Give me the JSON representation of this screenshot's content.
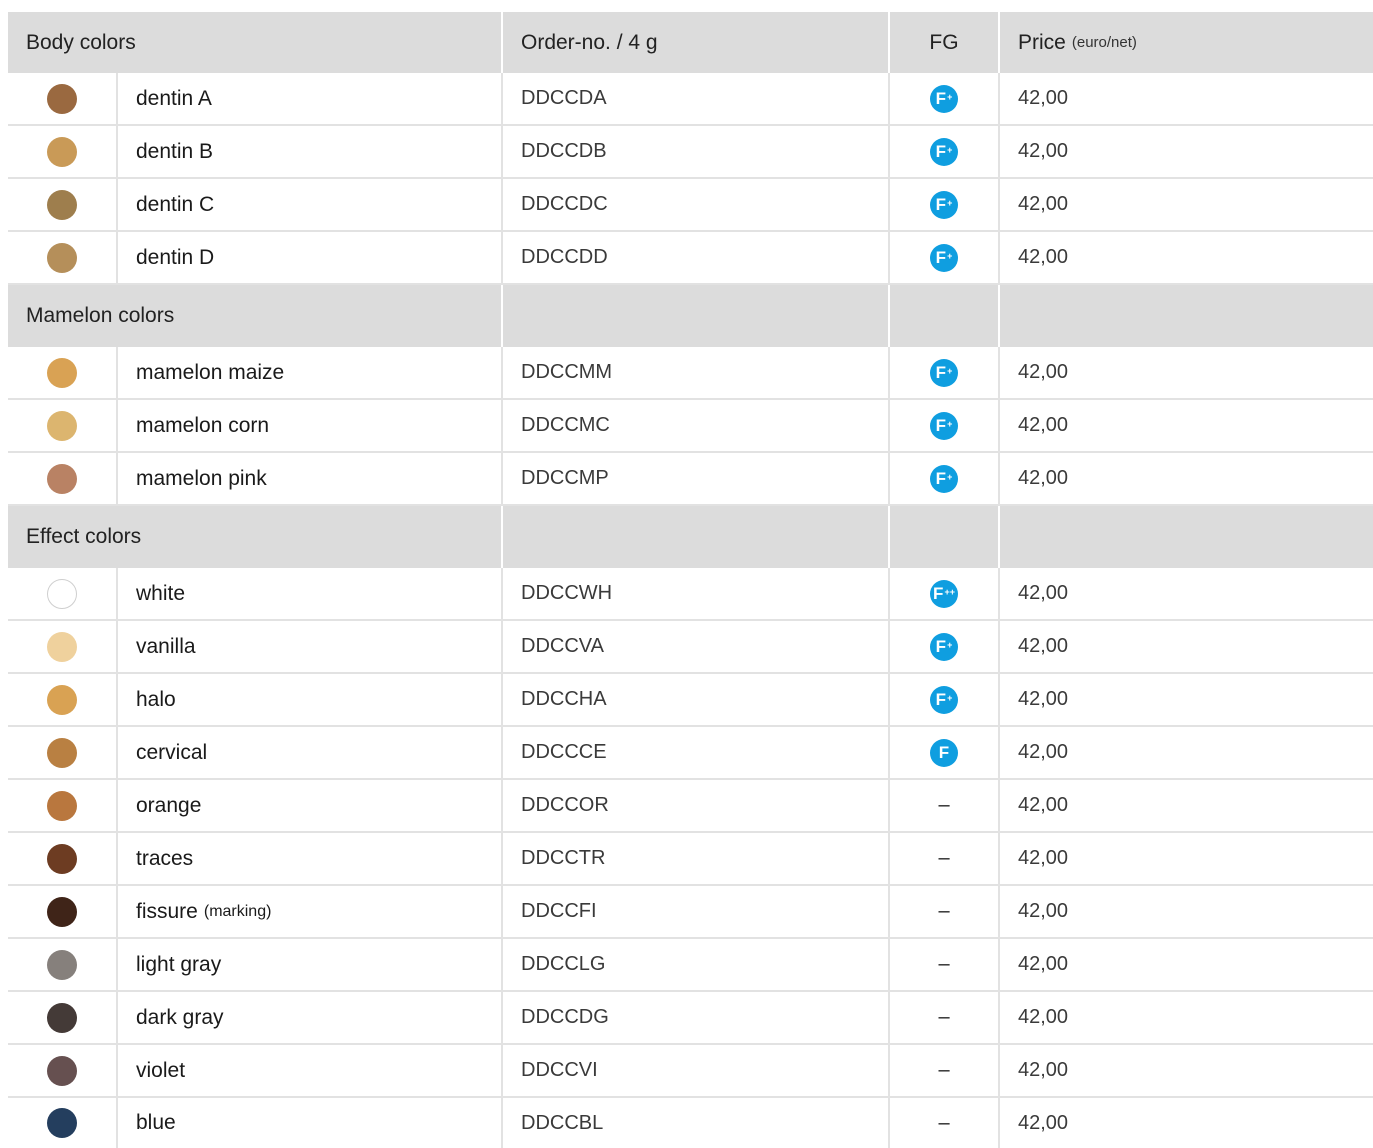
{
  "header": {
    "group_label": "Body colors",
    "order_label": "Order-no. / 4 g",
    "fg_label": "FG",
    "price_label": "Price",
    "price_unit": "(euro/net)"
  },
  "sections": [
    {
      "title": "Body colors",
      "is_header": true,
      "rows": [
        {
          "name": "dentin A",
          "note": "",
          "order": "DDCCDA",
          "fg": "F+",
          "price": "42,00",
          "swatch_color": "#9a6940"
        },
        {
          "name": "dentin B",
          "note": "",
          "order": "DDCCDB",
          "fg": "F+",
          "price": "42,00",
          "swatch_color": "#c99a57"
        },
        {
          "name": "dentin C",
          "note": "",
          "order": "DDCCDC",
          "fg": "F+",
          "price": "42,00",
          "swatch_color": "#9e7e4d"
        },
        {
          "name": "dentin D",
          "note": "",
          "order": "DDCCDD",
          "fg": "F+",
          "price": "42,00",
          "swatch_color": "#b58f5a"
        }
      ]
    },
    {
      "title": "Mamelon colors",
      "rows": [
        {
          "name": "mamelon maize",
          "note": "",
          "order": "DDCCMM",
          "fg": "F+",
          "price": "42,00",
          "swatch_color": "#d9a254"
        },
        {
          "name": "mamelon corn",
          "note": "",
          "order": "DDCCMC",
          "fg": "F+",
          "price": "42,00",
          "swatch_color": "#dcb56f"
        },
        {
          "name": "mamelon pink",
          "note": "",
          "order": "DDCCMP",
          "fg": "F+",
          "price": "42,00",
          "swatch_color": "#b98264"
        }
      ]
    },
    {
      "title": "Effect colors",
      "rows": [
        {
          "name": "white",
          "note": "",
          "order": "DDCCWH",
          "fg": "F++",
          "price": "42,00",
          "swatch_color": "#ffffff"
        },
        {
          "name": "vanilla",
          "note": "",
          "order": "DDCCVA",
          "fg": "F+",
          "price": "42,00",
          "swatch_color": "#efd19d"
        },
        {
          "name": "halo",
          "note": "",
          "order": "DDCCHA",
          "fg": "F+",
          "price": "42,00",
          "swatch_color": "#d9a253"
        },
        {
          "name": "cervical",
          "note": "",
          "order": "DDCCCE",
          "fg": "F",
          "price": "42,00",
          "swatch_color": "#b98042"
        },
        {
          "name": "orange",
          "note": "",
          "order": "DDCCOR",
          "fg": "–",
          "price": "42,00",
          "swatch_color": "#b9773e"
        },
        {
          "name": "traces",
          "note": "",
          "order": "DDCCTR",
          "fg": "–",
          "price": "42,00",
          "swatch_color": "#6d3c22"
        },
        {
          "name": "fissure",
          "note": "(marking)",
          "order": "DDCCFI",
          "fg": "–",
          "price": "42,00",
          "swatch_color": "#3f2418"
        },
        {
          "name": "light gray",
          "note": "",
          "order": "DDCCLG",
          "fg": "–",
          "price": "42,00",
          "swatch_color": "#86807c"
        },
        {
          "name": "dark gray",
          "note": "",
          "order": "DDCCDG",
          "fg": "–",
          "price": "42,00",
          "swatch_color": "#443a37"
        },
        {
          "name": "violet",
          "note": "",
          "order": "DDCCVI",
          "fg": "–",
          "price": "42,00",
          "swatch_color": "#665050"
        },
        {
          "name": "blue",
          "note": "",
          "order": "DDCCBL",
          "fg": "–",
          "price": "42,00",
          "swatch_color": "#243e5e"
        }
      ]
    }
  ],
  "colors": {
    "header_bg": "#dcdcdc",
    "grid_line": "#e2e2e2",
    "fg_badge": "#0f9ee0"
  }
}
